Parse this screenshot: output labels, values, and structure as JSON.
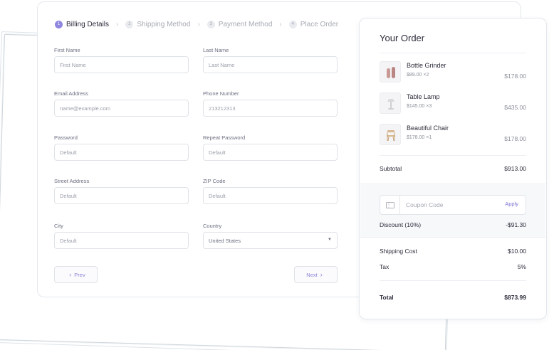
{
  "steps": [
    {
      "num": "1",
      "label": "Billing Details",
      "active": true
    },
    {
      "num": "2",
      "label": "Shipping Method",
      "active": false
    },
    {
      "num": "3",
      "label": "Payment Method",
      "active": false
    },
    {
      "num": "4",
      "label": "Place Order",
      "active": false
    }
  ],
  "form": {
    "first_name": {
      "label": "First Name",
      "placeholder": "First Name"
    },
    "last_name": {
      "label": "Last Name",
      "placeholder": "Last Name"
    },
    "email": {
      "label": "Email Address",
      "placeholder": "name@example.com"
    },
    "phone": {
      "label": "Phone Number",
      "placeholder": "213212313"
    },
    "password": {
      "label": "Password",
      "placeholder": "Default"
    },
    "repeat_password": {
      "label": "Repeat Password",
      "placeholder": "Default"
    },
    "street": {
      "label": "Street Address",
      "placeholder": "Default"
    },
    "zip": {
      "label": "ZIP Code",
      "placeholder": "Default"
    },
    "city": {
      "label": "City",
      "placeholder": "Default"
    },
    "country": {
      "label": "Country",
      "value": "United States"
    }
  },
  "nav": {
    "prev_label": "Prev",
    "next_label": "Next"
  },
  "order": {
    "title": "Your Order",
    "items": [
      {
        "name": "Bottle Grinder",
        "qty": "$89.00 ×2",
        "price": "$178.00",
        "icon": "bottle-grinder-icon"
      },
      {
        "name": "Table Lamp",
        "qty": "$145.00 ×3",
        "price": "$435.00",
        "icon": "table-lamp-icon"
      },
      {
        "name": "Beautiful Chair",
        "qty": "$178.00 ×1",
        "price": "$178.00",
        "icon": "chair-icon"
      }
    ],
    "subtotal_label": "Subtotal",
    "subtotal_value": "$913.00",
    "coupon_placeholder": "Coupon Code",
    "apply_label": "Apply",
    "discount_label": "Discount (10%)",
    "discount_value": "-$91.30",
    "shipping_label": "Shipping Cost",
    "shipping_value": "$10.00",
    "tax_label": "Tax",
    "tax_value": "5%",
    "total_label": "Total",
    "total_value": "$873.99"
  },
  "colors": {
    "accent": "#8f86e0",
    "link": "#7a72d2",
    "muted": "#9a9ea9"
  }
}
